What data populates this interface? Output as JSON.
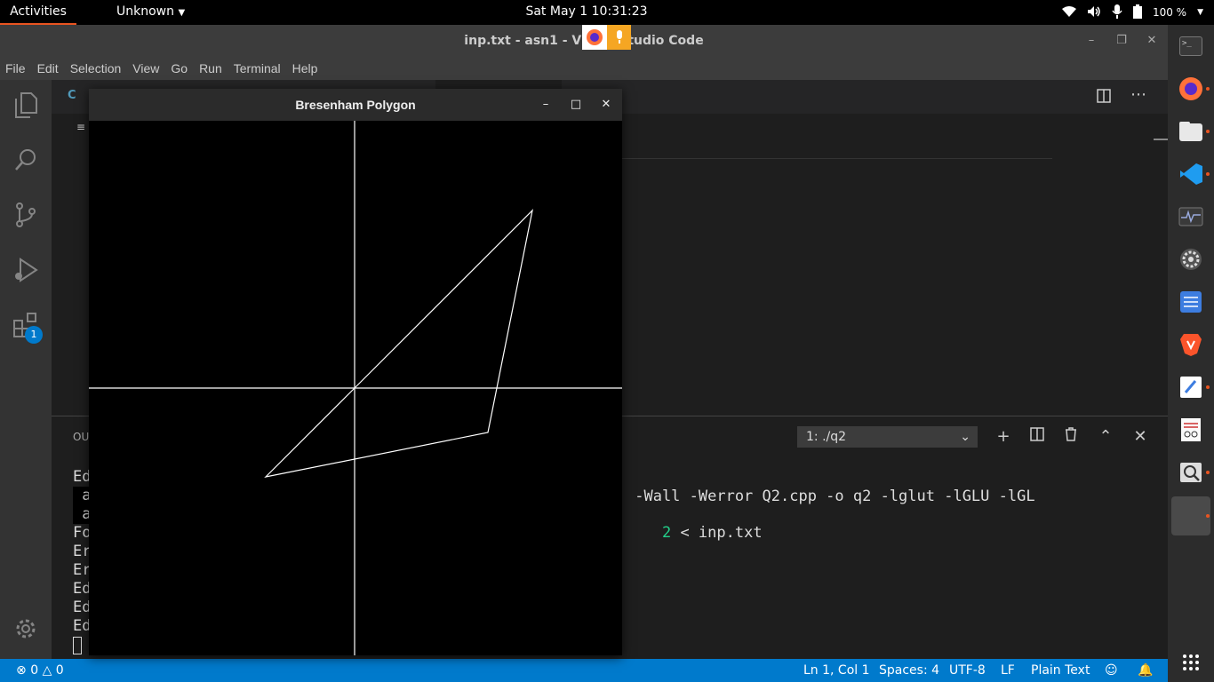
{
  "topbar": {
    "activities": "Activities",
    "app_menu": "Unknown",
    "clock": "Sat May 1  10:31:23",
    "battery": "100 %"
  },
  "vscode": {
    "window_title": "inp.txt - asn1 - Visual Studio Code",
    "menu": [
      "File",
      "Edit",
      "Selection",
      "View",
      "Go",
      "Run",
      "Terminal",
      "Help"
    ],
    "extensions_badge": "1",
    "panel": {
      "title_fragment": "OU",
      "terminal_select": "1: ./q2",
      "lines_left": [
        "Ed",
        " a",
        " a",
        "Fo",
        "Er",
        "Er",
        "Ed",
        "Ed",
        "Ed"
      ],
      "command_1": " -Wall -Werror Q2.cpp -o q2 -lglut -lGLU -lGL",
      "command_2_prefix": "2",
      "command_2_rest": " < inp.txt"
    },
    "status": {
      "errors": "0",
      "warnings": "0",
      "position": "Ln 1, Col 1",
      "spaces": "Spaces: 4",
      "encoding": "UTF-8",
      "eol": "LF",
      "language": "Plain Text"
    }
  },
  "glut_window": {
    "title": "Bresenham Polygon",
    "polygon": {
      "axis_x": true,
      "axis_y": true,
      "vertices": [
        [
          0,
          0
        ],
        [
          200,
          200
        ],
        [
          150,
          -50
        ],
        [
          -100,
          -100
        ]
      ],
      "color": "#ffffff",
      "background": "#000000"
    }
  },
  "dock": [
    "terminal-icon",
    "firefox-icon",
    "files-icon",
    "vscode-icon",
    "system-monitor-icon",
    "settings-icon",
    "tasks-icon",
    "brave-icon",
    "text-editor-icon",
    "document-viewer-icon",
    "image-viewer-icon",
    "blank-window-icon",
    "show-apps-icon"
  ],
  "colors": {
    "accent": "#e95420",
    "statusbar": "#007acc"
  }
}
